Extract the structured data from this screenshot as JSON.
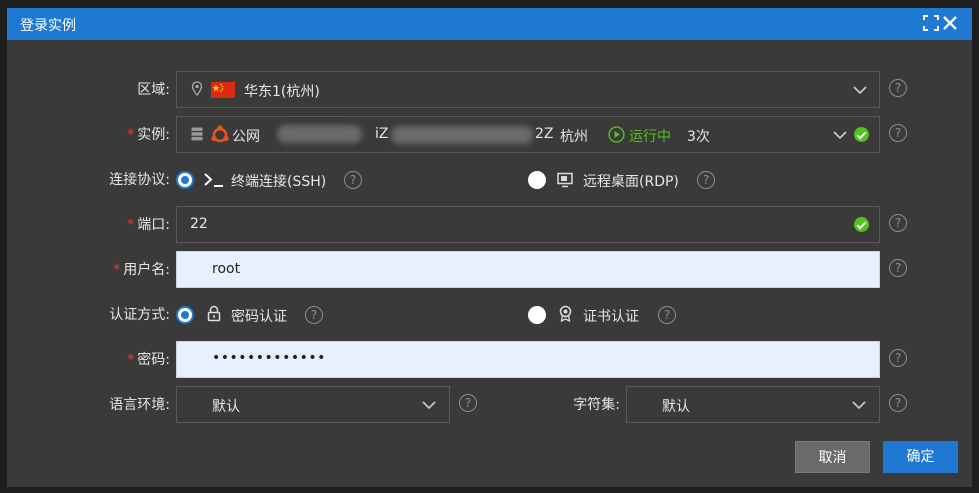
{
  "dialog": {
    "title": "登录实例"
  },
  "region": {
    "label": "区域:",
    "value": "华东1(杭州)"
  },
  "instance": {
    "label": "实例:",
    "network": "公网",
    "id_prefix": "iZ",
    "id_suffix": "2Z",
    "city": "杭州",
    "status": "运行中",
    "count": "3次",
    "status_color": "#52c41a"
  },
  "protocol": {
    "label": "连接协议:",
    "option_ssh": "终端连接(SSH)",
    "option_rdp": "远程桌面(RDP)",
    "selected": "ssh"
  },
  "port": {
    "label": "端口:",
    "value": "22"
  },
  "username": {
    "label": "用户名:",
    "value": "root"
  },
  "auth": {
    "label": "认证方式:",
    "option_password": "密码认证",
    "option_cert": "证书认证",
    "selected": "password"
  },
  "password": {
    "label": "密码:",
    "value": "•••••••••••••"
  },
  "language": {
    "label": "语言环境:",
    "value": "默认"
  },
  "charset": {
    "label": "字符集:",
    "value": "默认"
  },
  "buttons": {
    "cancel": "取消",
    "ok": "确定"
  },
  "colors": {
    "accent": "#1f78d1",
    "success": "#52c41a",
    "required": "#e03c3c"
  }
}
